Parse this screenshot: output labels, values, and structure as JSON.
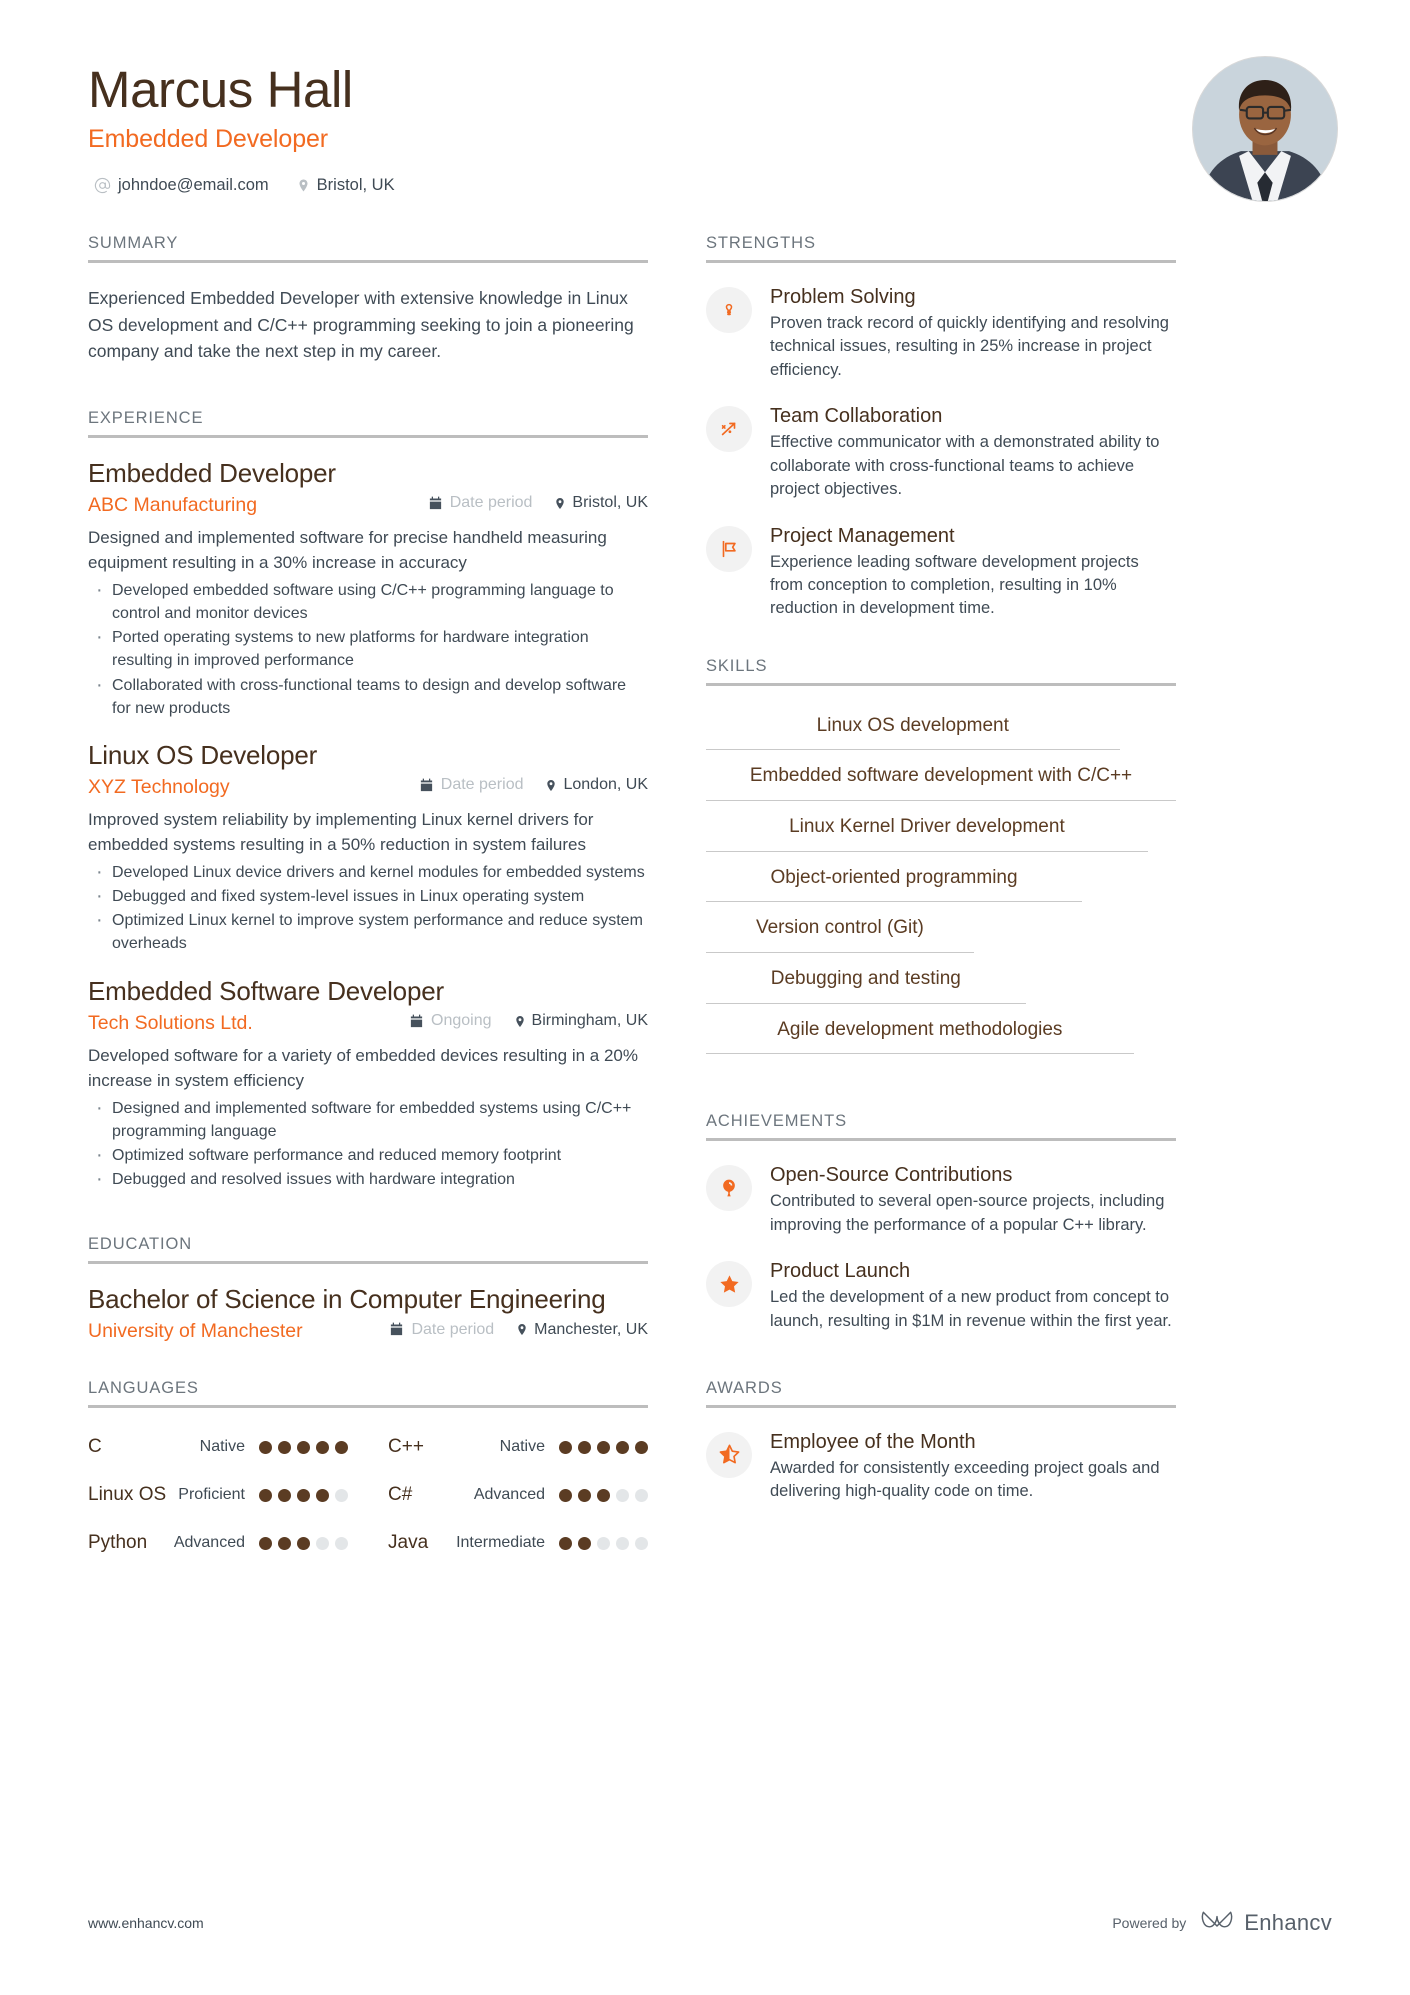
{
  "colors": {
    "accent_orange": "#f26a21",
    "heading_brown": "#46301e",
    "skill_brown": "#5b3c23",
    "body_text": "#3f4a54",
    "muted": "#6c757d",
    "rule": "#bdbdbd"
  },
  "header": {
    "name": "Marcus Hall",
    "job_title": "Embedded Developer",
    "email": "johndoe@email.com",
    "location": "Bristol, UK",
    "email_icon": "at-icon",
    "location_icon": "map-pin-icon",
    "avatar_icon": "profile-photo"
  },
  "summary": {
    "heading": "SUMMARY",
    "text": "Experienced Embedded Developer with extensive knowledge in Linux OS development and C/C++ programming seeking to join a pioneering company and take the next step in my career."
  },
  "experience": {
    "heading": "EXPERIENCE",
    "entries": [
      {
        "title": "Embedded Developer",
        "company": "ABC Manufacturing",
        "date": "Date period",
        "location": "Bristol, UK",
        "description": "Designed and implemented software for precise handheld measuring equipment resulting in a 30% increase in accuracy",
        "bullets": [
          "Developed embedded software using C/C++ programming language to control and monitor devices",
          "Ported operating systems to new platforms for hardware integration resulting in improved performance",
          "Collaborated with cross-functional teams to design and develop software for new products"
        ]
      },
      {
        "title": "Linux OS Developer",
        "company": "XYZ Technology",
        "date": "Date period",
        "location": "London, UK",
        "description": "Improved system reliability by implementing Linux kernel drivers for embedded systems resulting in a 50% reduction in system failures",
        "bullets": [
          "Developed Linux device drivers and kernel modules for embedded systems",
          "Debugged and fixed system-level issues in Linux operating system",
          "Optimized Linux kernel to improve system performance and reduce system overheads"
        ]
      },
      {
        "title": "Embedded Software Developer",
        "company": "Tech Solutions Ltd.",
        "date": "Ongoing",
        "location": "Birmingham, UK",
        "description": "Developed software for a variety of embedded devices resulting in a 20% increase in system efficiency",
        "bullets": [
          "Designed and implemented software for embedded systems using C/C++ programming language",
          "Optimized software performance and reduced memory footprint",
          "Debugged and resolved issues with hardware integration"
        ]
      }
    ]
  },
  "education": {
    "heading": "EDUCATION",
    "entries": [
      {
        "degree": "Bachelor of Science in Computer Engineering",
        "school": "University of Manchester",
        "date": "Date period",
        "location": "Manchester, UK"
      }
    ]
  },
  "languages": {
    "heading": "LANGUAGES",
    "items": [
      {
        "name": "C",
        "level": "Native",
        "filled": 5,
        "total": 5
      },
      {
        "name": "C++",
        "level": "Native",
        "filled": 5,
        "total": 5
      },
      {
        "name": "Linux OS",
        "level": "Proficient",
        "filled": 4,
        "total": 5
      },
      {
        "name": "C#",
        "level": "Advanced",
        "filled": 3,
        "total": 5
      },
      {
        "name": "Python",
        "level": "Advanced",
        "filled": 3,
        "total": 5
      },
      {
        "name": "Java",
        "level": "Intermediate",
        "filled": 2,
        "total": 5
      }
    ]
  },
  "strengths": {
    "heading": "STRENGTHS",
    "items": [
      {
        "icon": "lightbulb-icon",
        "title": "Problem Solving",
        "desc": "Proven track record of quickly identifying and resolving technical issues, resulting in 25% increase in project efficiency."
      },
      {
        "icon": "network-nodes-icon",
        "title": "Team Collaboration",
        "desc": "Effective communicator with a demonstrated ability to collaborate with cross-functional teams to achieve project objectives."
      },
      {
        "icon": "flag-icon",
        "title": "Project Management",
        "desc": "Experience leading software development projects from conception to completion, resulting in 10% reduction in development time."
      }
    ]
  },
  "skills": {
    "heading": "SKILLS",
    "items": [
      "Linux OS development",
      "Embedded software development with C/C++",
      "Linux Kernel Driver development",
      "Object-oriented programming",
      "Version control (Git)",
      "Debugging and testing",
      "Agile development methodologies"
    ]
  },
  "achievements": {
    "heading": "ACHIEVEMENTS",
    "items": [
      {
        "icon": "balloon-icon",
        "title": "Open-Source Contributions",
        "desc": "Contributed to several open-source projects, including improving the performance of a popular C++ library."
      },
      {
        "icon": "star-filled-icon",
        "title": "Product Launch",
        "desc": "Led the development of a new product from concept to launch, resulting in $1M in revenue within the first year."
      }
    ]
  },
  "awards": {
    "heading": "AWARDS",
    "items": [
      {
        "icon": "star-half-icon",
        "title": "Employee of the Month",
        "desc": "Awarded for consistently exceeding project goals and delivering high-quality code on time."
      }
    ]
  },
  "footer": {
    "url": "www.enhancv.com",
    "powered_by": "Powered by",
    "brand": "Enhancv",
    "brand_icon": "enhancv-logo-icon"
  }
}
